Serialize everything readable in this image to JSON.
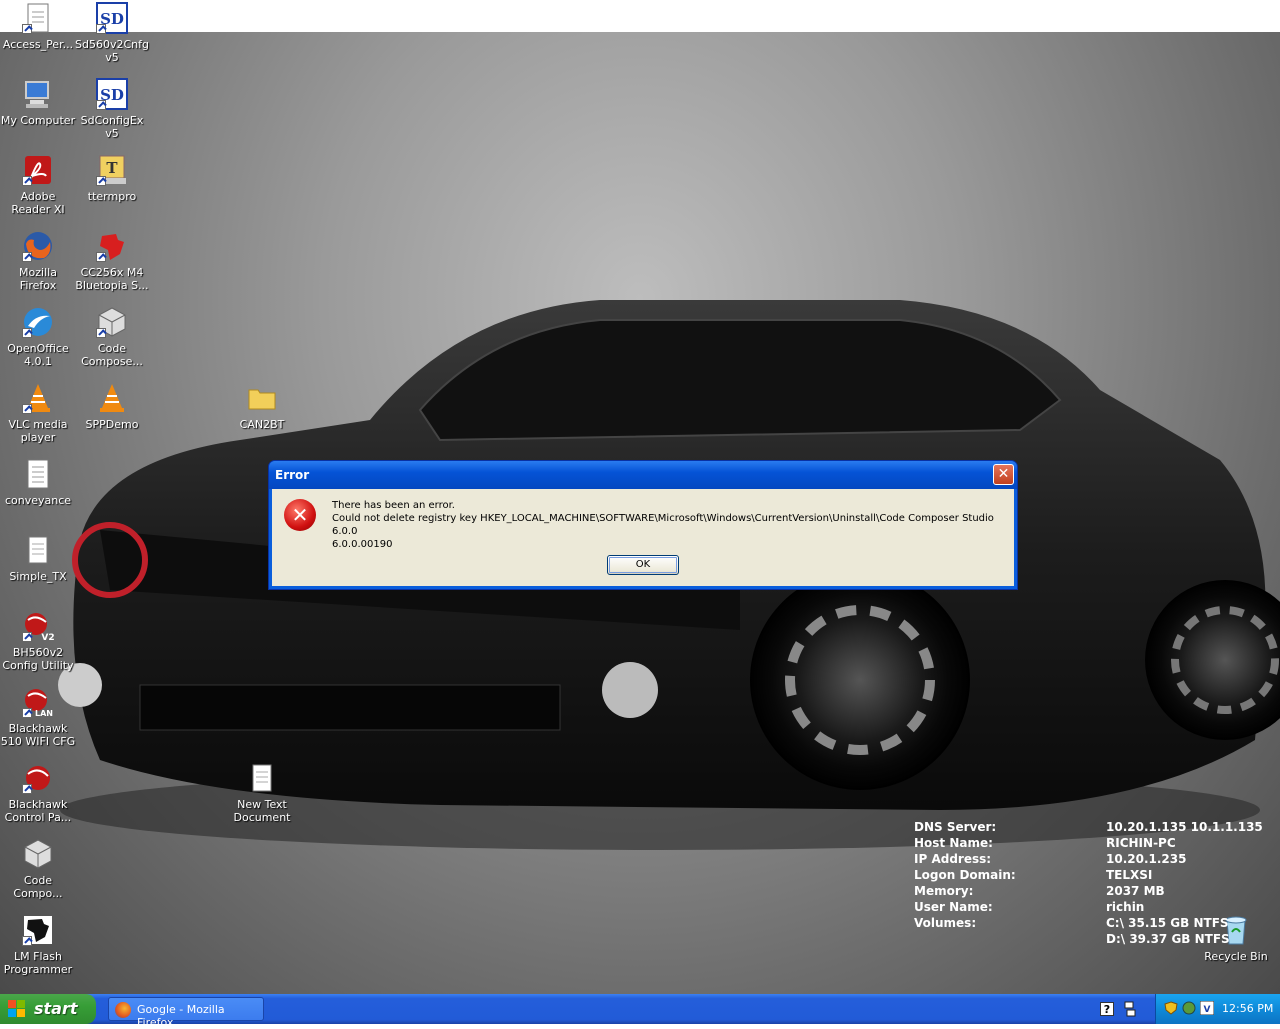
{
  "desktop": {
    "icons": [
      {
        "label": "Access_Per..."
      },
      {
        "label": "Sd560v2Cnfg v5"
      },
      {
        "label": "My Computer"
      },
      {
        "label": "SdConfigEx v5"
      },
      {
        "label": "Adobe Reader XI"
      },
      {
        "label": "ttermpro"
      },
      {
        "label": "Mozilla Firefox"
      },
      {
        "label": "CC256x M4 Bluetopia S..."
      },
      {
        "label": "OpenOffice 4.0.1"
      },
      {
        "label": "Code Compose..."
      },
      {
        "label": "VLC media player"
      },
      {
        "label": "SPPDemo"
      },
      {
        "label": "CAN2BT"
      },
      {
        "label": "conveyance"
      },
      {
        "label": "Simple_TX"
      },
      {
        "label": "BH560v2 Config Utility"
      },
      {
        "label": "Blackhawk 510 WIFI CFG"
      },
      {
        "label": "Blackhawk Control Pa..."
      },
      {
        "label": "New Text Document"
      },
      {
        "label": "Code Compo..."
      },
      {
        "label": "LM Flash Programmer"
      },
      {
        "label": "Recycle Bin"
      }
    ],
    "icon_badges": {
      "sd": "SD",
      "ttermpro": "T",
      "bh560v2": "V2",
      "bh510": "LAN"
    }
  },
  "sysinfo": {
    "rows": [
      {
        "key": "DNS Server:",
        "value": "10.20.1.135 10.1.1.135"
      },
      {
        "key": "Host Name:",
        "value": "RICHIN-PC"
      },
      {
        "key": "IP Address:",
        "value": "10.20.1.235"
      },
      {
        "key": "Logon Domain:",
        "value": "TELXSI"
      },
      {
        "key": "Memory:",
        "value": "2037 MB"
      },
      {
        "key": "User Name:",
        "value": "richin"
      },
      {
        "key": "Volumes:",
        "value": "C:\\ 35.15 GB NTFS"
      },
      {
        "key": "",
        "value": "D:\\ 39.37 GB NTFS"
      }
    ]
  },
  "dialog": {
    "title": "Error",
    "close_glyph": "✕",
    "error_glyph": "✕",
    "line1": "There has been an error.",
    "line2": "Could not delete registry key HKEY_LOCAL_MACHINE\\SOFTWARE\\Microsoft\\Windows\\CurrentVersion\\Uninstall\\Code Composer Studio 6.0.0",
    "line3": "6.0.0.00190",
    "ok_label": "OK"
  },
  "taskbar": {
    "start_label": "start",
    "tasks": [
      {
        "label": "Google - Mozilla Firefox"
      }
    ],
    "help_glyph": "?",
    "clock": "12:56 PM"
  },
  "colors": {
    "taskbar_blue": "#245edb",
    "start_green": "#379e37",
    "dialog_title_blue": "#0553d6",
    "dialog_body": "#ece9d8",
    "error_red": "#d01010"
  }
}
